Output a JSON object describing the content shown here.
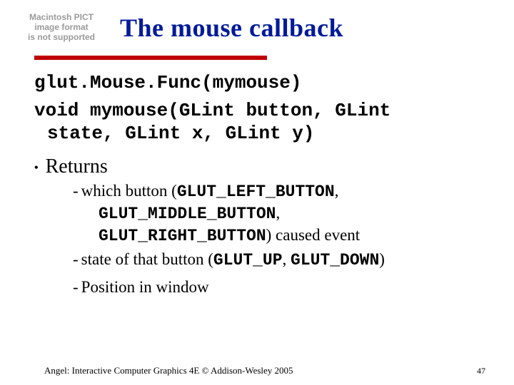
{
  "placeholder": {
    "line1": "Macintosh PICT",
    "line2": "image format",
    "line3": "is not supported"
  },
  "title": "The mouse callback",
  "code": {
    "line1": "glut.Mouse.Func(mymouse)",
    "line2a": "void mymouse(GLint button, GLint",
    "line2b": "state, GLint x, GLint y)"
  },
  "returns": {
    "label": "Returns",
    "items": [
      {
        "pre1": "which button (",
        "c1": "GLUT_LEFT_BUTTON",
        "post1": ",",
        "c2": "GLUT_MIDDLE_BUTTON",
        "post2": ",",
        "c3": "GLUT_RIGHT_BUTTON",
        "post3": ") caused event"
      },
      {
        "pre": "state of that button (",
        "c1": "GLUT_UP",
        "mid": ", ",
        "c2": "GLUT_DOWN",
        "post": ")"
      },
      {
        "text": "Position in window"
      }
    ]
  },
  "footer": {
    "left": "Angel: Interactive Computer Graphics 4E © Addison-Wesley 2005",
    "right": "47"
  }
}
